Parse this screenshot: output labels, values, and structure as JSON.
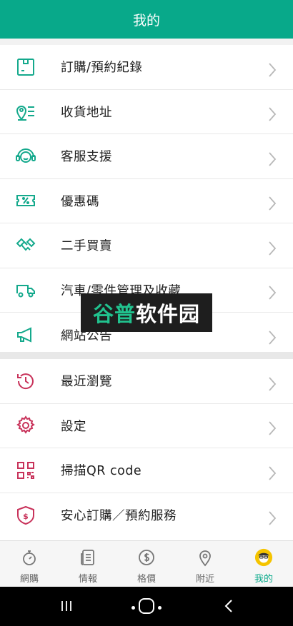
{
  "header": {
    "title": "我的"
  },
  "menu_section_1": [
    {
      "label": "訂購/預約紀錄",
      "icon": "order-record-icon"
    },
    {
      "label": "收貨地址",
      "icon": "address-icon"
    },
    {
      "label": "客服支援",
      "icon": "customer-service-icon"
    },
    {
      "label": "優惠碼",
      "icon": "coupon-icon"
    },
    {
      "label": "二手買賣",
      "icon": "handshake-icon"
    },
    {
      "label": "汽車/零件管理及收藏",
      "icon": "car-icon"
    },
    {
      "label": "網站公告",
      "icon": "megaphone-icon"
    }
  ],
  "menu_section_2": [
    {
      "label": "最近瀏覽",
      "icon": "history-icon"
    },
    {
      "label": "設定",
      "icon": "gear-icon"
    },
    {
      "label": "掃描QR code",
      "icon": "qr-code-icon"
    },
    {
      "label": "安心訂購／預約服務",
      "icon": "shield-icon"
    }
  ],
  "watermark": {
    "part1": "谷普",
    "part2": "软件园"
  },
  "tabbar": [
    {
      "label": "網購",
      "icon": "timer-icon"
    },
    {
      "label": "情報",
      "icon": "news-icon"
    },
    {
      "label": "格價",
      "icon": "price-icon"
    },
    {
      "label": "附近",
      "icon": "location-pin-icon"
    },
    {
      "label": "我的",
      "icon": "profile-avatar-icon",
      "active": true
    }
  ],
  "colors": {
    "brand": "#08a98a",
    "icon_teal": "#14a98c",
    "icon_pink": "#c8325a",
    "active_yellow": "#f5c400"
  }
}
